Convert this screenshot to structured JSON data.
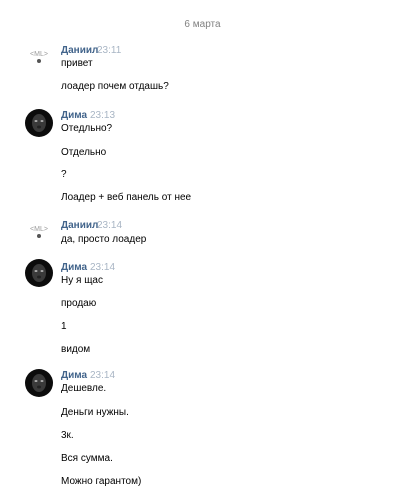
{
  "date_separator": "6 марта",
  "colors": {
    "name": "#42648b",
    "time": "#a8b5c4",
    "date": "#828282"
  },
  "groups": [
    {
      "author": "Даниил",
      "time": "23:11",
      "avatar": "ml-logo-icon",
      "avatar_text": "<ML>",
      "messages": [
        "привет",
        "лоадер почем отдашь?"
      ]
    },
    {
      "author": "Дима",
      "time": "23:13",
      "avatar": "dark-face-avatar",
      "messages": [
        "Отедльно?",
        "Отдельно",
        "?",
        "Лоадер + веб панель от нее"
      ]
    },
    {
      "author": "Даниил",
      "time": "23:14",
      "avatar": "ml-logo-icon",
      "avatar_text": "<ML>",
      "messages": [
        "да, просто лоадер"
      ]
    },
    {
      "author": "Дима",
      "time": "23:14",
      "avatar": "dark-face-avatar",
      "messages": [
        "Ну я щас",
        "продаю",
        "1",
        "видом"
      ]
    },
    {
      "author": "Дима",
      "time": "23:14",
      "avatar": "dark-face-avatar",
      "messages": [
        "Дешевле.",
        "Деньги нужны.",
        "3к.",
        "Вся сумма.",
        "Можно гарантом)"
      ]
    }
  ]
}
